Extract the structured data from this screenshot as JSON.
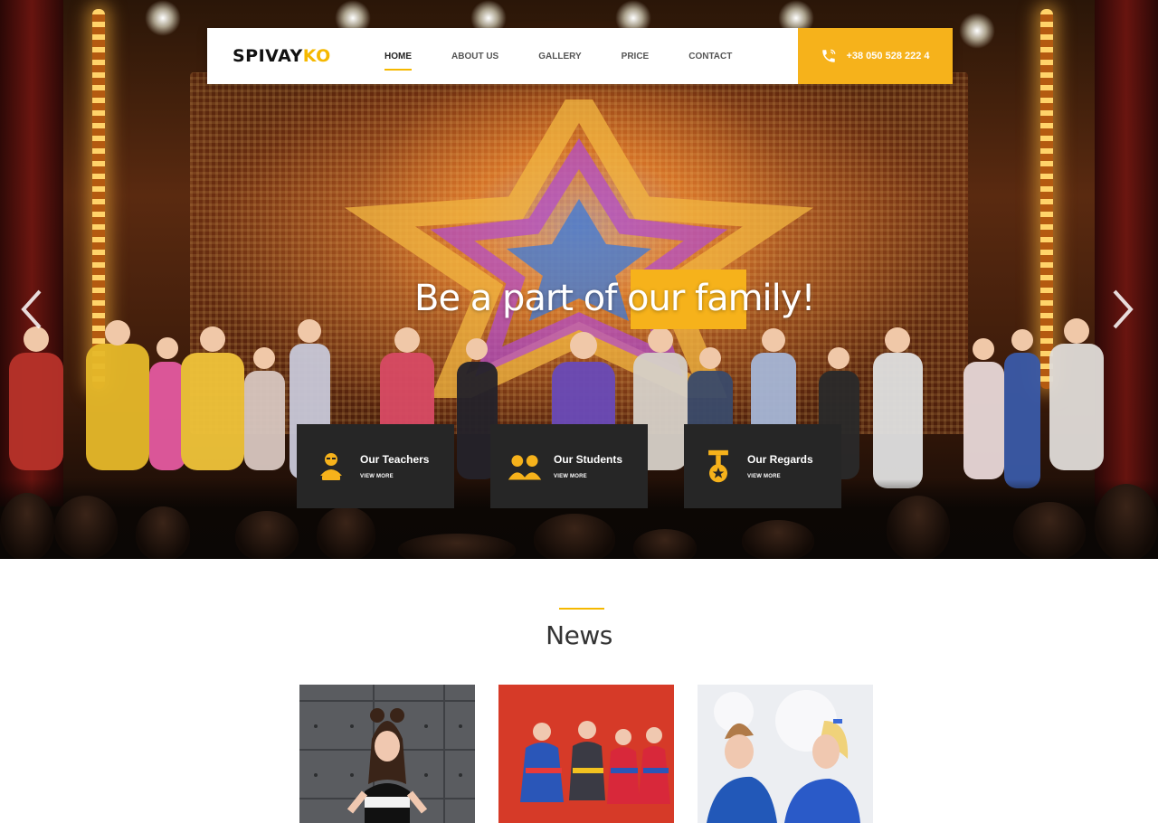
{
  "brand": {
    "logo_dark": "SPIVAY",
    "logo_accent": "KO"
  },
  "nav": {
    "items": [
      {
        "label": "HOME",
        "active": true
      },
      {
        "label": "ABOUT US",
        "active": false
      },
      {
        "label": "GALLERY",
        "active": false
      },
      {
        "label": "PRICE",
        "active": false
      },
      {
        "label": "CONTACT",
        "active": false
      }
    ],
    "phone": "+38 050 528 222 4",
    "phone_icon": "phone-icon"
  },
  "hero": {
    "headline": "Be a part of our family!",
    "prev_icon": "chevron-left-icon",
    "next_icon": "chevron-right-icon"
  },
  "features": [
    {
      "title": "Our Teachers",
      "link": "VIEW MORE",
      "icon": "teacher-icon"
    },
    {
      "title": "Our Students",
      "link": "VIEW MORE",
      "icon": "students-icon"
    },
    {
      "title": "Our Regards",
      "link": "VIEW MORE",
      "icon": "medal-icon"
    }
  ],
  "news": {
    "title": "News"
  },
  "colors": {
    "accent": "#f6b21b",
    "card_bg": "#262626",
    "text_dark": "#333333"
  }
}
